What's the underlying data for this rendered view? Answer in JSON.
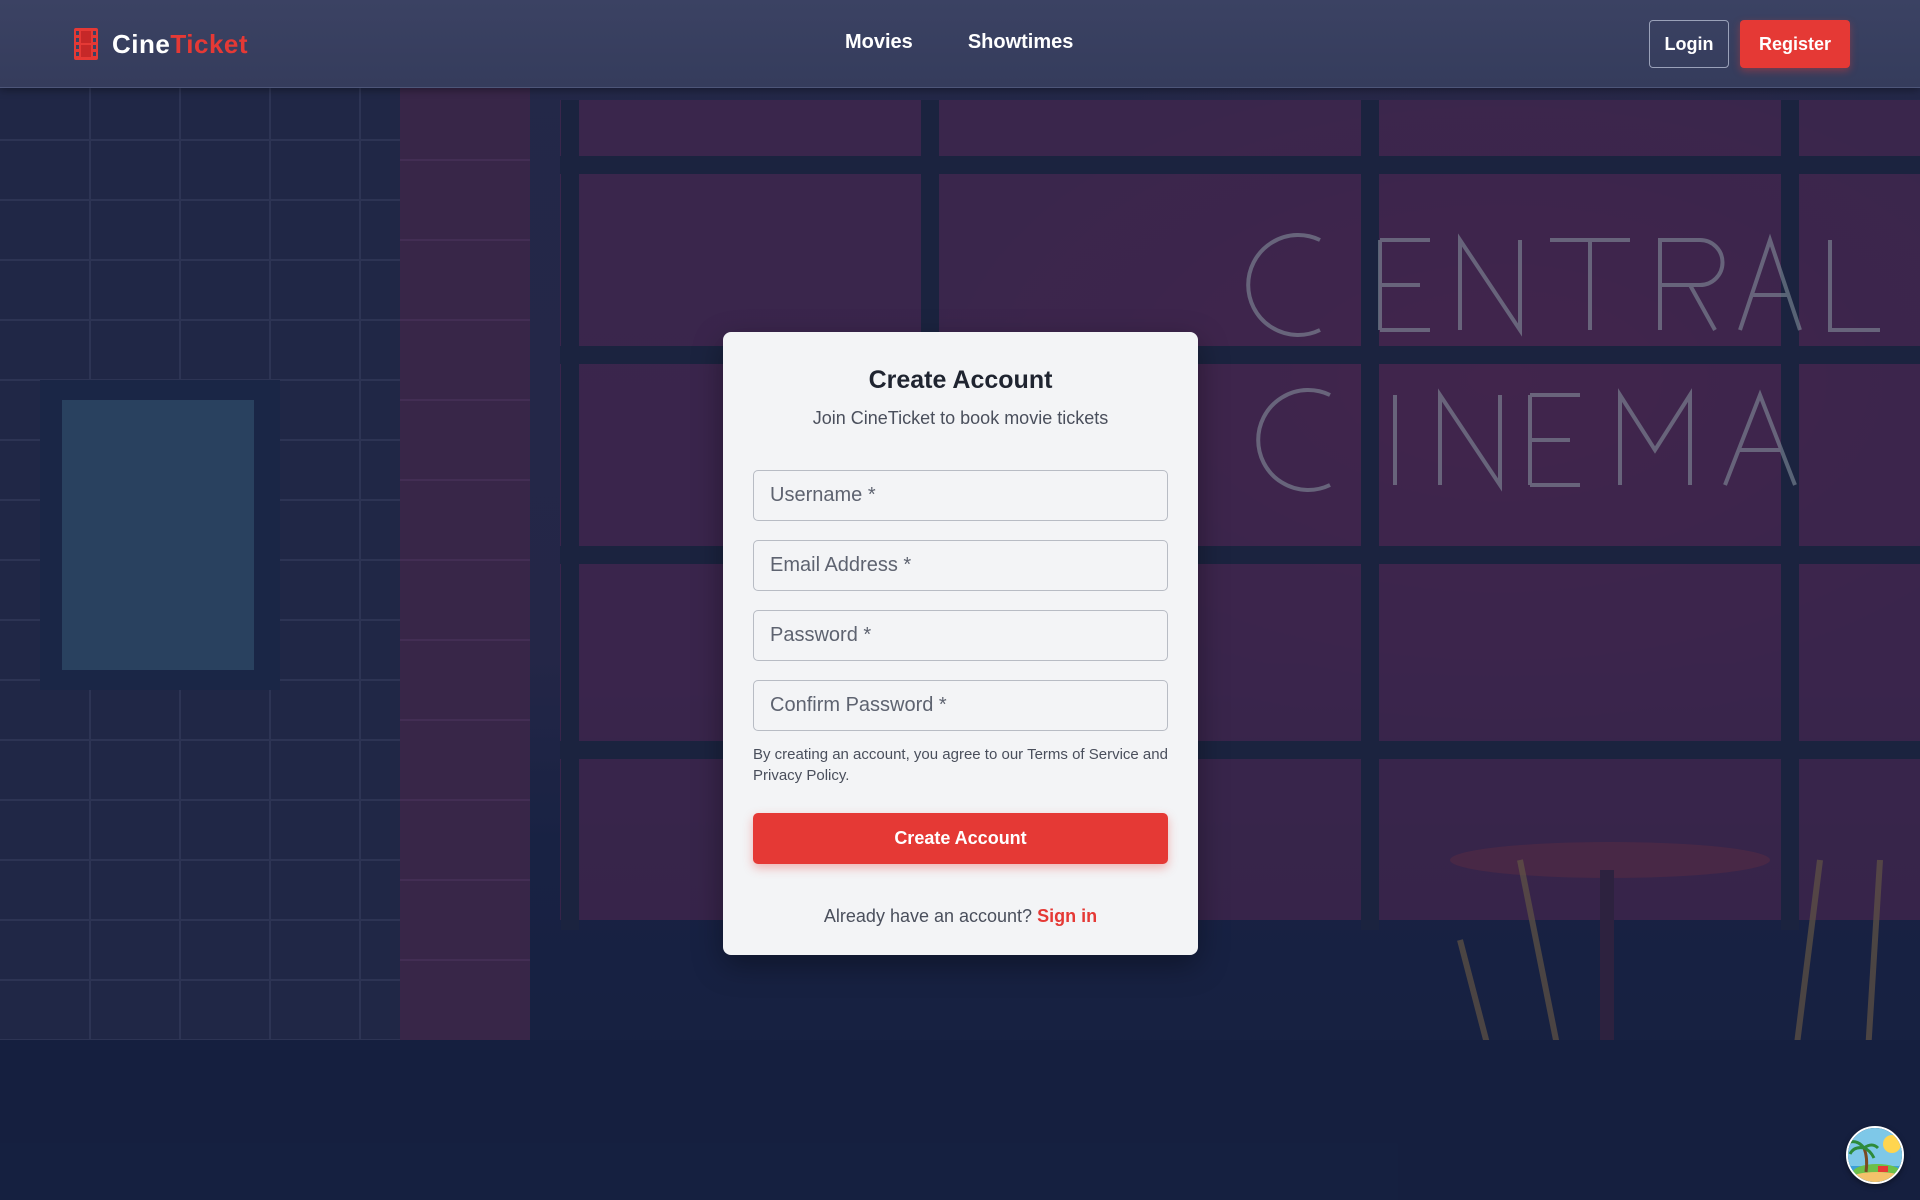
{
  "header": {
    "brand_part1": "Cine",
    "brand_part2": "Ticket",
    "nav": [
      {
        "label": "Movies"
      },
      {
        "label": "Showtimes"
      }
    ],
    "login_label": "Login",
    "register_label": "Register"
  },
  "form": {
    "title": "Create Account",
    "subtitle": "Join CineTicket to book movie tickets",
    "fields": [
      {
        "placeholder": "Username *",
        "value": ""
      },
      {
        "placeholder": "Email Address *",
        "value": ""
      },
      {
        "placeholder": "Password *",
        "value": ""
      },
      {
        "placeholder": "Confirm Password *",
        "value": ""
      }
    ],
    "terms": "By creating an account, you agree to our Terms of Service and Privacy Policy.",
    "submit_label": "Create Account",
    "signin_prompt": "Already have an account?",
    "signin_link": "Sign in"
  },
  "colors": {
    "accent": "#e53935",
    "navbar": "#3b4263",
    "card": "#f3f4f6"
  },
  "icons": {
    "brand": "film-icon",
    "widget": "beach-island-icon"
  }
}
